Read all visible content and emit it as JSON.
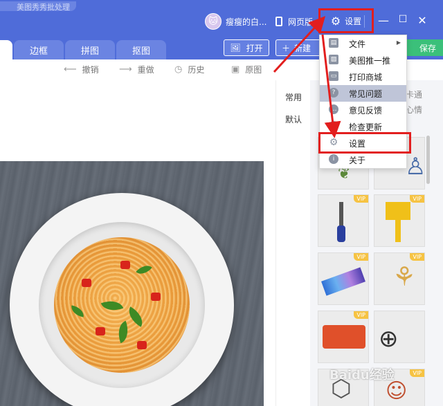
{
  "titlebar": {
    "doc_tab_text": "美图秀秀批处理",
    "user_name": "瘦瘦的白...",
    "web_label": "网页版",
    "settings_label": "设置",
    "avatar_glyph": "🐱",
    "minimize": "—",
    "maximize": "☐",
    "close": "✕"
  },
  "tabs": {
    "items": [
      {
        "label": "边框"
      },
      {
        "label": "拼图"
      },
      {
        "label": "抠图"
      }
    ],
    "open_label": "打开",
    "new_label": "新建",
    "save_label": "保存"
  },
  "toolbar": {
    "undo": "撤销",
    "redo": "重做",
    "history": "历史",
    "original": "原图"
  },
  "side": {
    "tab_common": "常用",
    "tab_default": "默认",
    "cat1": "卡通",
    "cat2": "心情",
    "vip": "VIP"
  },
  "menu": {
    "items": [
      {
        "label": "文件",
        "icon": "file-icon"
      },
      {
        "label": "美图推一推",
        "icon": "image-icon"
      },
      {
        "label": "打印商城",
        "icon": "printer-icon"
      },
      {
        "label": "常见问题",
        "icon": "question-icon"
      },
      {
        "label": "意见反馈",
        "icon": "feedback-icon"
      },
      {
        "label": "检查更新",
        "icon": "update-icon"
      },
      {
        "label": "设置",
        "icon": "gear-icon"
      },
      {
        "label": "关于",
        "icon": "info-icon"
      }
    ]
  },
  "watermark": "Baidu经验",
  "colors": {
    "brand_blue": "#4f6cd9",
    "save_green": "#3bc07a",
    "annotation_red": "#e21e1e",
    "vip_gold": "#f6c343"
  }
}
